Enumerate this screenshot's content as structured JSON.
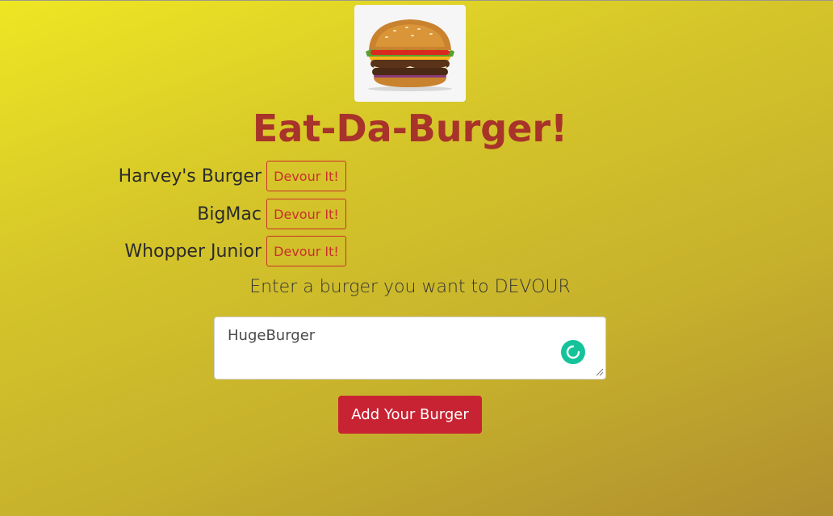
{
  "header": {
    "logo_icon": "burger-image",
    "title": "Eat-Da-Burger!"
  },
  "burgers": [
    {
      "name": "Harvey's Burger",
      "button_label": "Devour It!"
    },
    {
      "name": "BigMac",
      "button_label": "Devour It!"
    },
    {
      "name": "Whopper Junior",
      "button_label": "Devour It!"
    }
  ],
  "form": {
    "prompt": "Enter a burger you want to DEVOUR",
    "input_value": "HugeBurger",
    "submit_label": "Add Your Burger",
    "grammar_icon": "grammarly-icon"
  },
  "colors": {
    "title": "#a8332a",
    "devour_border": "#c9302c",
    "submit_bg": "#c82333",
    "background_start": "#eee623",
    "background_end": "#b08f2f"
  }
}
